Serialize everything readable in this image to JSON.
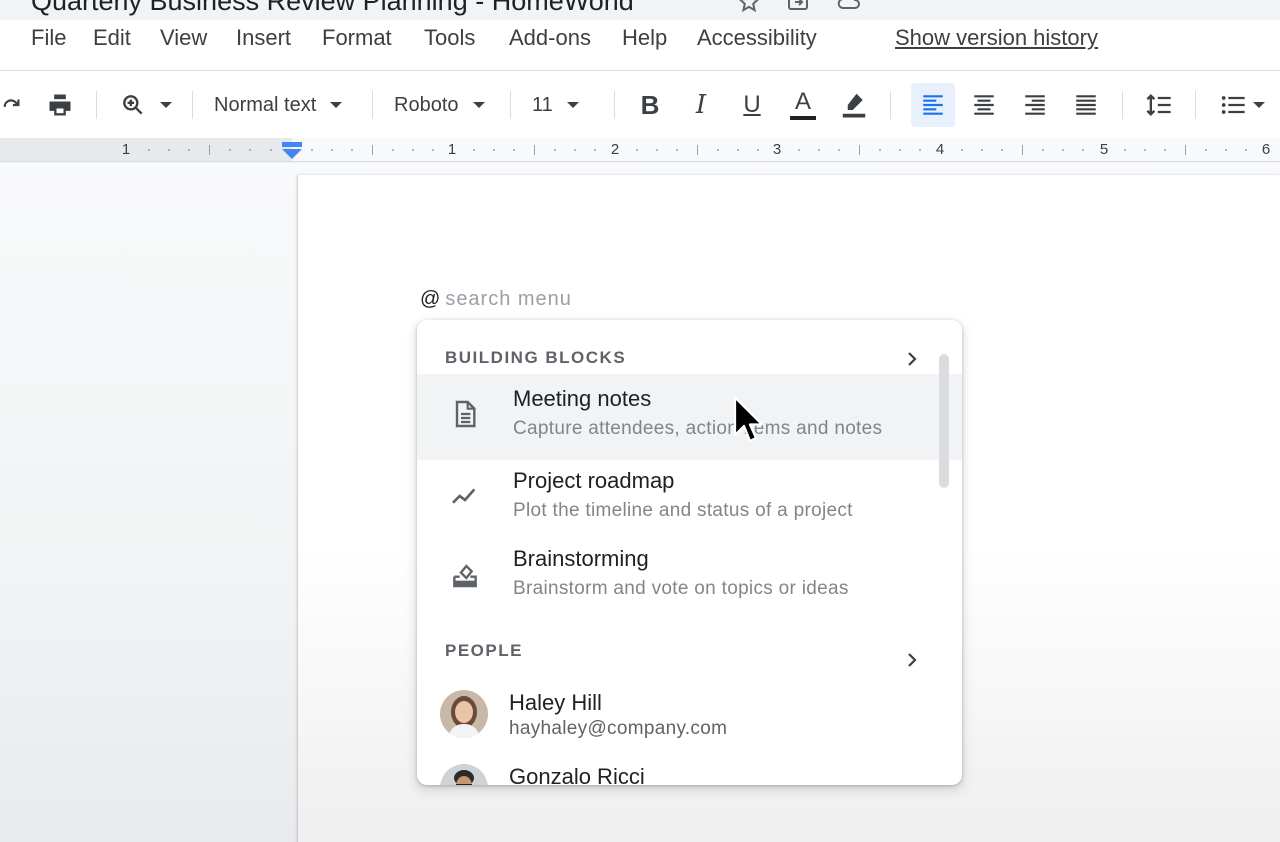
{
  "document": {
    "title": "Quarterly Business Review Planning - HomeWorld"
  },
  "menu": {
    "items": [
      "File",
      "Edit",
      "View",
      "Insert",
      "Format",
      "Tools",
      "Add-ons",
      "Help",
      "Accessibility"
    ],
    "version_history": "Show version history"
  },
  "toolbar": {
    "style": "Normal text",
    "font": "Roboto",
    "font_size": "11",
    "active_alignment": "left",
    "icons": [
      "redo-icon",
      "print-icon",
      "zoom-icon",
      "bold-icon",
      "italic-icon",
      "underline-icon",
      "text-color-icon",
      "highlight-icon",
      "align-left-icon",
      "align-center-icon",
      "align-right-icon",
      "justify-icon",
      "line-spacing-icon",
      "bulleted-list-icon"
    ],
    "bold_label": "B",
    "italic_label": "I",
    "underline_label": "U",
    "text_color_label": "A"
  },
  "ruler": {
    "labels": [
      "1",
      "1",
      "2",
      "3",
      "4",
      "5",
      "6"
    ]
  },
  "editor": {
    "at_symbol": "@",
    "search_placeholder": "search menu"
  },
  "dropdown": {
    "building_blocks": {
      "header": "BUILDING BLOCKS",
      "items": [
        {
          "title": "Meeting notes",
          "subtitle": "Capture attendees, action items and notes",
          "icon": "document-icon"
        },
        {
          "title": "Project roadmap",
          "subtitle": "Plot the timeline and status of a project",
          "icon": "trend-line-icon"
        },
        {
          "title": "Brainstorming",
          "subtitle": "Brainstorm and vote on topics or ideas",
          "icon": "ballot-box-icon"
        }
      ]
    },
    "people": {
      "header": "PEOPLE",
      "items": [
        {
          "name": "Haley Hill",
          "email": "hayhaley@company.com"
        },
        {
          "name": "Gonzalo Ricci",
          "email": ""
        }
      ]
    }
  },
  "colors": {
    "accent": "#4285f4",
    "active_button_bg": "#e8f0fe",
    "text_primary": "#202124",
    "text_secondary": "#80868b"
  }
}
